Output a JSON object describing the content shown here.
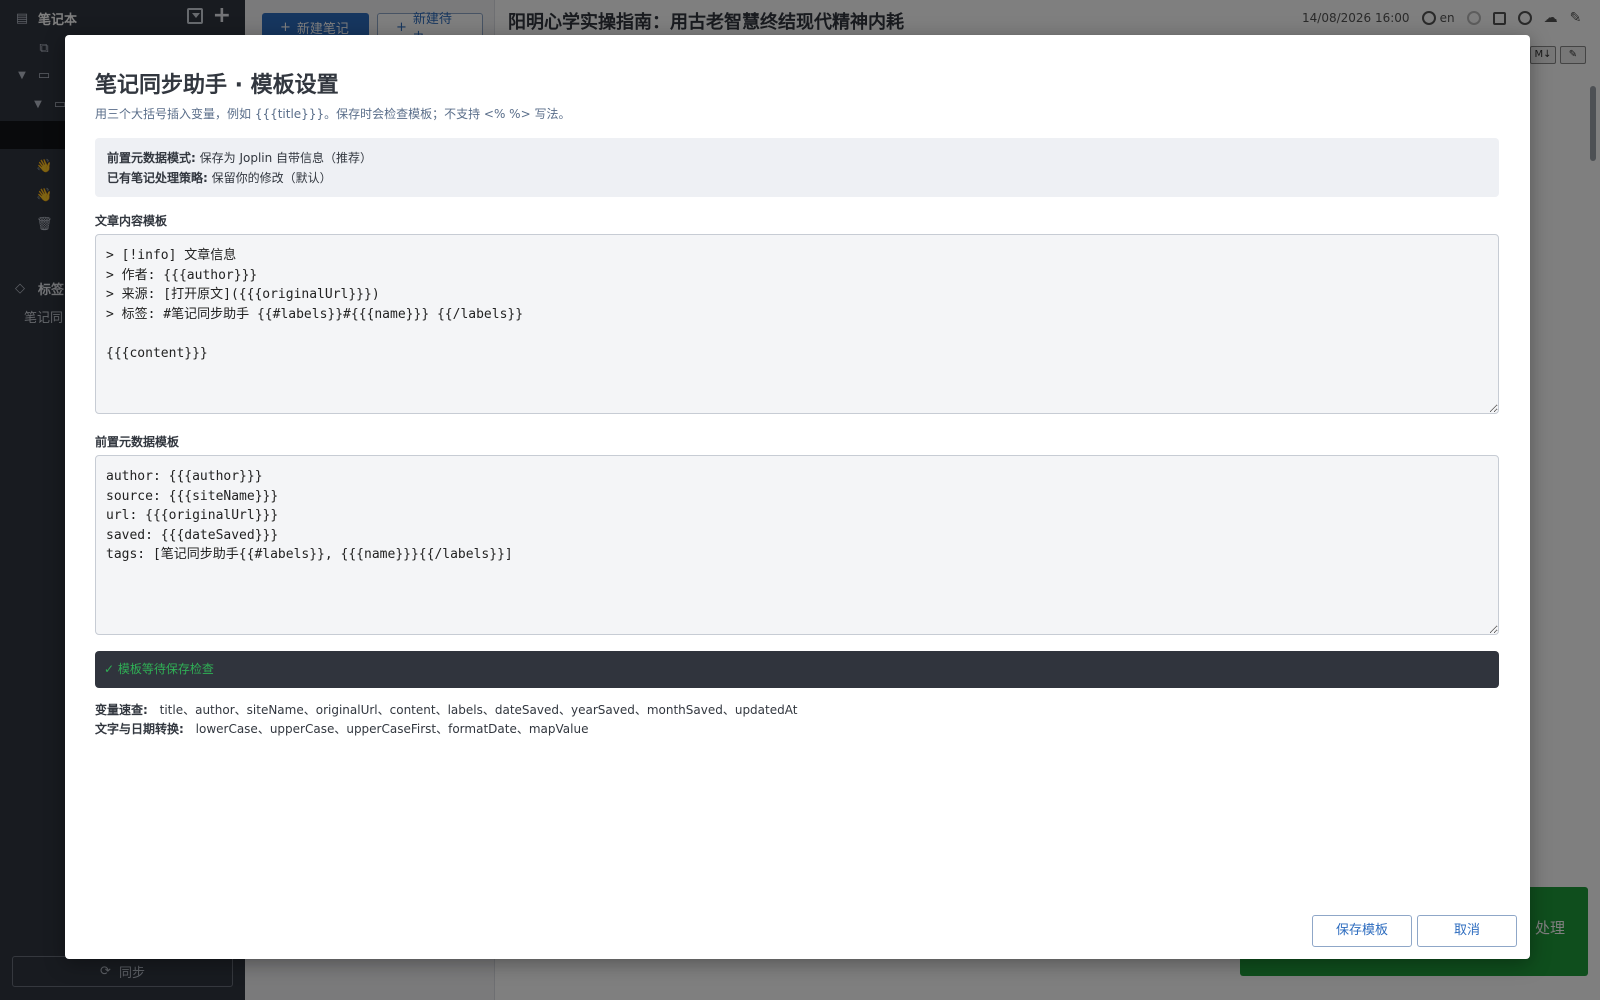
{
  "sidebar": {
    "header_title": "笔记本",
    "tags_title": "标签",
    "tag_item": "笔记同",
    "sync_label": "同步"
  },
  "notes_list": {
    "new_note_label": "新建笔记",
    "new_todo_label": "新建待办"
  },
  "editor": {
    "title": "阳明心学实操指南：用古老智慧终结现代精神内耗",
    "datetime": "14/08/2026 16:00",
    "language": "en",
    "toolbar_md": "M↓"
  },
  "toast": {
    "label": "处理"
  },
  "dialog": {
    "title": "笔记同步助手 · 模板设置",
    "subtitle": "用三个大括号插入变量，例如 {{{title}}}。保存时会检查模板；不支持 <% %> 写法。",
    "info": {
      "frontmatter_mode_label": "前置元数据模式:",
      "frontmatter_mode_value": "保存为 Joplin 自带信息（推荐）",
      "existing_policy_label": "已有笔记处理策略:",
      "existing_policy_value": "保留你的修改（默认）"
    },
    "content_template_label": "文章内容模板",
    "content_template_value": "> [!info] 文章信息\n> 作者: {{{author}}}\n> 来源: [打开原文]({{{originalUrl}}})\n> 标签: #笔记同步助手 {{#labels}}#{{{name}}} {{/labels}}\n\n{{{content}}}",
    "frontmatter_template_label": "前置元数据模板",
    "frontmatter_template_value": "author: {{{author}}}\nsource: {{{siteName}}}\nurl: {{{originalUrl}}}\nsaved: {{{dateSaved}}}\ntags: [笔记同步助手{{#labels}}, {{{name}}}{{/labels}}]",
    "status_text": "✓ 模板等待保存检查",
    "vars_label": "变量速查:",
    "vars_list": "title、author、siteName、originalUrl、content、labels、dateSaved、yearSaved、monthSaved、updatedAt",
    "funcs_label": "文字与日期转换:",
    "funcs_list": "lowerCase、upperCase、upperCaseFirst、formatDate、mapValue",
    "save_label": "保存模板",
    "cancel_label": "取消"
  },
  "colors": {
    "sidebar_bg": "#313640",
    "accent": "#2d6cbf",
    "status_green": "#2faf55",
    "toast_green": "#1f9c3a"
  }
}
